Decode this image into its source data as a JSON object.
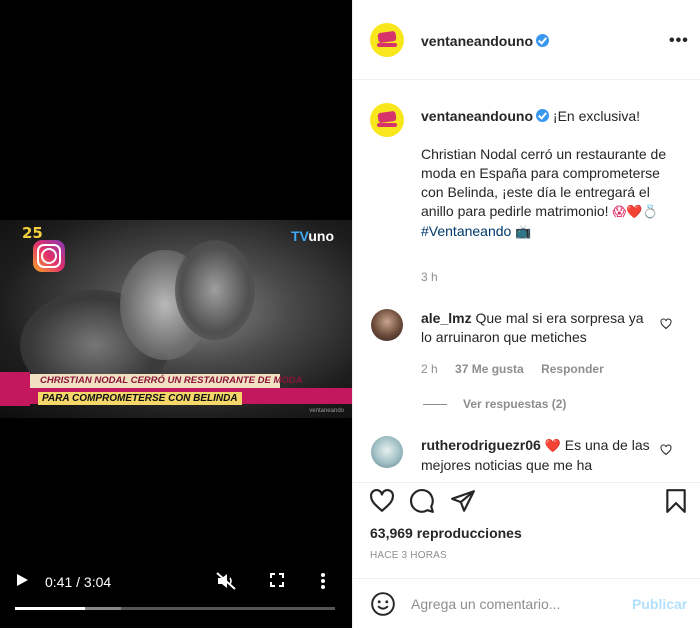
{
  "post": {
    "username": "ventaneandouno",
    "verified": true,
    "more_icon": "more-horizontal-icon"
  },
  "video": {
    "overlay_logo_left": "25",
    "overlay_logo_right_prefix": "TV",
    "overlay_logo_right_suffix": "uno",
    "banner_line1": "CHRISTIAN NODAL CERRÓ UN RESTAURANTE DE MODA",
    "banner_line2": "PARA COMPROMETERSE CON BELINDA",
    "watermark": "ventaneando",
    "time": "0:41 / 3:04",
    "progress": 0.22,
    "buffered": 0.33
  },
  "caption": {
    "username": "ventaneandouno",
    "line1": "¡En exclusiva!",
    "body": "Christian Nodal cerró un restaurante de moda en España para comprometerse con Belinda, ¡este día le entregará el anillo para pedirle matrimonio!",
    "emojis": "😱❤️💍",
    "hashtag": "#Ventaneando",
    "tv_emoji": "📺",
    "time": "3 h"
  },
  "comments": [
    {
      "username": "ale_lmz",
      "text": "Que mal si era sorpresa ya lo arruinaron que metiches",
      "time": "2 h",
      "likes": "37 Me gusta",
      "reply": "Responder",
      "view_replies": "Ver respuestas (2)"
    },
    {
      "username": "rutherodriguezr06",
      "emoji": "❤️",
      "text": "Es una de las mejores noticias que me ha"
    }
  ],
  "stats": {
    "views_count": "63,969",
    "views_label": "reproducciones",
    "timestamp": "HACE 3 HORAS"
  },
  "composer": {
    "placeholder": "Agrega un comentario...",
    "post_label": "Publicar"
  },
  "colors": {
    "accent_blue": "#3897f0",
    "heart_red": "#e0245e",
    "publish_disabled": "#b2dffc",
    "banner_pink": "#c3185e",
    "banner_yellow": "#f6d86a"
  }
}
